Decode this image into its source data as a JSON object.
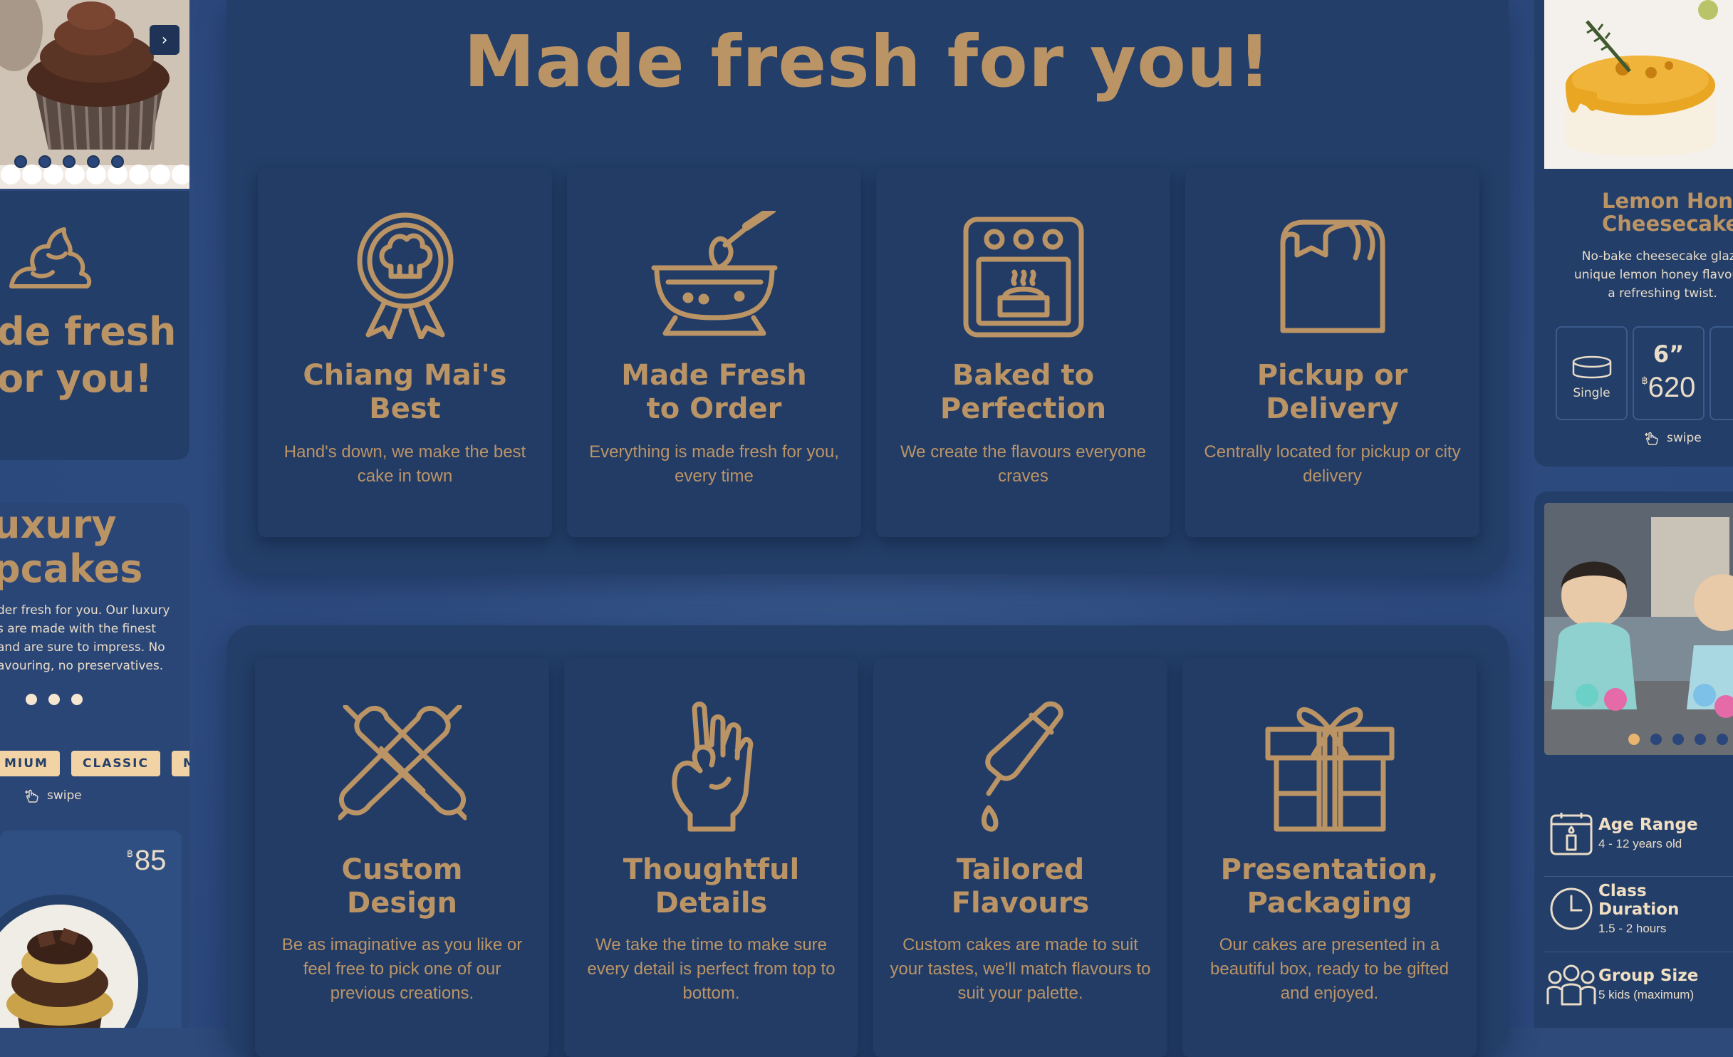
{
  "colors": {
    "gold": "#bb9466",
    "navy": "#233e68",
    "cream": "#e9dcc9",
    "tag": "#f2d3a6"
  },
  "left": {
    "next_icon": "chevron-right-icon",
    "card1_title_line1": "de fresh",
    "card1_title_line2": "or you!",
    "card2_title_line1": "uxury",
    "card2_title_line2": "pcakes",
    "card2_desc": [
      "der fresh for you. Our luxury",
      "s are made with the finest",
      "and are sure to impress. No",
      "avouring, no preservatives."
    ],
    "tags": [
      "MIUM",
      "CLASSIC",
      "MIN"
    ],
    "swipe": "swipe",
    "currency": "฿",
    "price": "85"
  },
  "main": {
    "title": "Made fresh for you!",
    "features_top": [
      {
        "title": "Chiang Mai's Best",
        "text": "Hand's down, we make the best cake in town",
        "icon": "award-chef-hat-icon"
      },
      {
        "title": "Made Fresh to Order",
        "text": "Everything is made fresh for you, every time",
        "icon": "mixing-bowl-whisk-icon"
      },
      {
        "title": "Baked to Perfection",
        "text": "We create the flavours everyone craves",
        "icon": "oven-icon"
      },
      {
        "title": "Pickup or Delivery",
        "text": "Centrally located for pickup or city delivery",
        "icon": "paper-bag-icon"
      }
    ],
    "features_bottom": [
      {
        "title": "Custom Design",
        "text": "Be as imaginative as you like or feel free to pick one of our previous creations.",
        "icon": "rolling-pin-icon"
      },
      {
        "title": "Thoughtful Details",
        "text": "We take the time to make sure every detail is perfect from top to bottom.",
        "icon": "ok-hand-icon"
      },
      {
        "title": "Tailored Flavours",
        "text": "Custom cakes are made to suit your tastes, we'll match flavours to suit your palette.",
        "icon": "piping-bottle-icon"
      },
      {
        "title": "Presentation, Packaging",
        "text": "Our cakes are presented in a beautiful box, ready to be gifted and enjoyed.",
        "icon": "gift-box-icon"
      }
    ]
  },
  "right": {
    "title_line1": "Lemon Hone",
    "title_line2": "Cheesecake",
    "desc": [
      "No-bake cheesecake glaze",
      "unique lemon honey flavours",
      "a refreshing twist."
    ],
    "opt1_label": "Single",
    "opt2_size": "6”",
    "currency": "฿",
    "opt2_price": "620",
    "swipe": "swipe",
    "info": [
      {
        "title": "Age Range",
        "sub": "4 - 12 years old",
        "icon": "candle-icon"
      },
      {
        "title": "Class Duration",
        "sub": "1.5 - 2 hours",
        "icon": "clock-icon"
      },
      {
        "title": "Group Size",
        "sub": "5 kids (maximum)",
        "icon": "group-icon"
      }
    ]
  }
}
